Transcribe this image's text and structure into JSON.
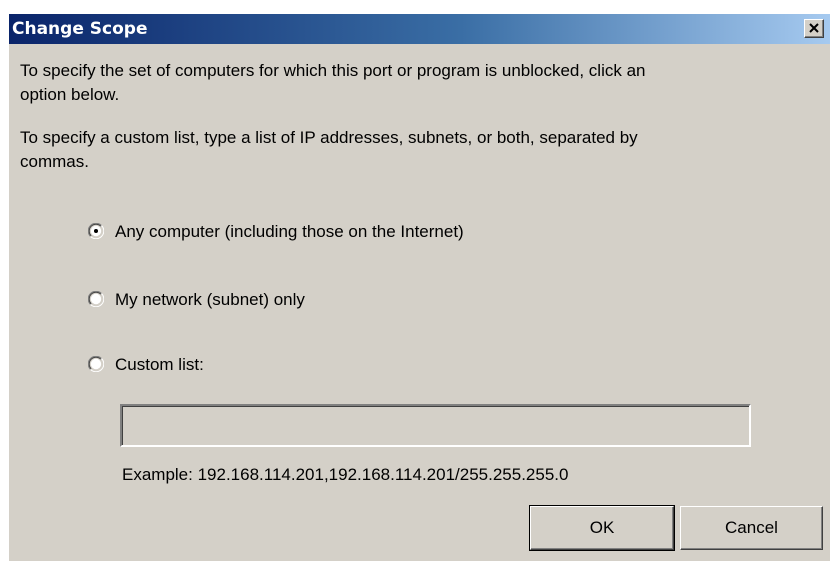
{
  "dialog": {
    "title": "Change Scope",
    "close_glyph": "close-icon"
  },
  "instructions": {
    "line1a": "To specify the set of computers for which this port or program is unblocked, click an",
    "line1b": "option below.",
    "line2a": "To specify a custom list, type a list of IP addresses, subnets, or both, separated by",
    "line2b": "commas."
  },
  "scope_options": [
    {
      "label": "Any computer (including those on the Internet)",
      "selected": true
    },
    {
      "label": "My network (subnet) only",
      "selected": false
    },
    {
      "label": "Custom list:",
      "selected": false
    }
  ],
  "custom_list": {
    "value": "",
    "example": "Example: 192.168.114.201,192.168.114.201/255.255.255.0"
  },
  "buttons": {
    "ok": "OK",
    "cancel": "Cancel"
  },
  "colors": {
    "face": "#d4d0c8",
    "title_start": "#0a246a",
    "title_end": "#a6caf0"
  }
}
